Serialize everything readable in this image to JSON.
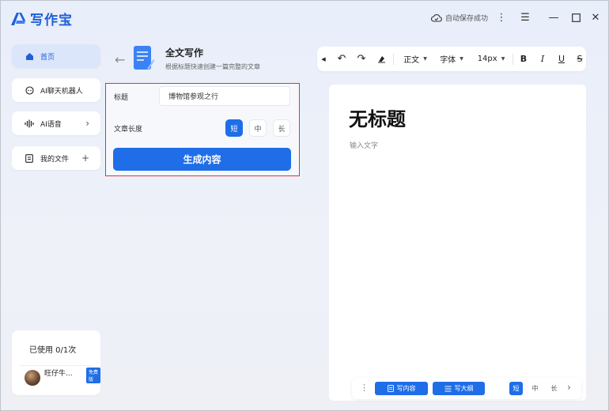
{
  "app": {
    "name": "写作宝",
    "autosave": "自动保存成功"
  },
  "sidebar": {
    "items": [
      {
        "label": "首页"
      },
      {
        "label": "AI聊天机器人"
      },
      {
        "label": "AI语音"
      },
      {
        "label": "我的文件"
      }
    ],
    "usage": "已使用 0/1次",
    "user": {
      "name": "旺仔牛...",
      "badge": "免费版"
    }
  },
  "panel": {
    "title": "全文写作",
    "subtitle": "根据标题快速创建一篇完整的文章",
    "title_label": "标题",
    "title_value": "博物馆参观之行",
    "length_label": "文章长度",
    "lengths": [
      "短",
      "中",
      "长"
    ],
    "generate": "生成内容"
  },
  "toolbar": {
    "style": "正文",
    "font": "字体",
    "size": "14px",
    "bold": "B",
    "italic": "I",
    "underline": "U",
    "strike": "S"
  },
  "editor": {
    "title": "无标题",
    "placeholder": "输入文字"
  },
  "bottom": {
    "write_content": "写内容",
    "write_outline": "写大纲",
    "lengths": [
      "短",
      "中",
      "长"
    ]
  },
  "colors": {
    "accent": "#1f6ee8",
    "highlight_border": "#d9363e"
  }
}
